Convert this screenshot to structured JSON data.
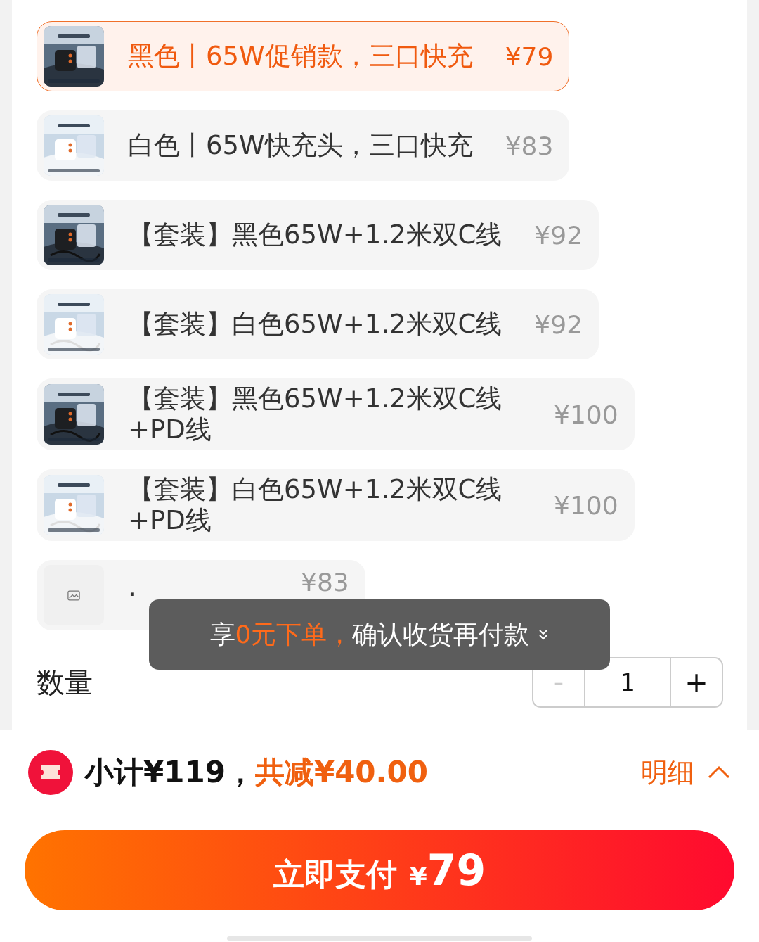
{
  "options": [
    {
      "kind": "picture",
      "label": "黑色丨65W促销款，三口快充",
      "price": "¥79",
      "selected": true
    },
    {
      "kind": "picture",
      "label": "白色丨65W快充头，三口快充",
      "price": "¥83",
      "selected": false
    },
    {
      "kind": "picture",
      "label": "【套装】黑色65W+1.2米双C线",
      "price": "¥92",
      "selected": false
    },
    {
      "kind": "picture",
      "label": "【套装】白色65W+1.2米双C线",
      "price": "¥92",
      "selected": false
    },
    {
      "kind": "picture",
      "label": "【套装】黑色65W+1.2米双C线+PD线",
      "price": "¥100",
      "selected": false
    },
    {
      "kind": "picture",
      "label": "【套装】白色65W+1.2米双C线+PD线",
      "price": "¥100",
      "selected": false
    },
    {
      "kind": "placeholder",
      "label": "·",
      "price": "¥83",
      "selected": false
    }
  ],
  "tooltip": {
    "parts": [
      {
        "text": "享",
        "highlight": false
      },
      {
        "text": "0元下单，",
        "highlight": true
      },
      {
        "text": "确认收货再付款",
        "highlight": false
      }
    ]
  },
  "quantity": {
    "label": "数量",
    "minus": "-",
    "value": "1",
    "plus": "+",
    "minus_disabled": true
  },
  "summary": {
    "subtotal": "小计¥119，",
    "discount": "共减¥40.00",
    "details": "明细",
    "details_expanded": false
  },
  "pay_button": {
    "label": "立即支付",
    "currency": "¥",
    "amount": "79"
  }
}
